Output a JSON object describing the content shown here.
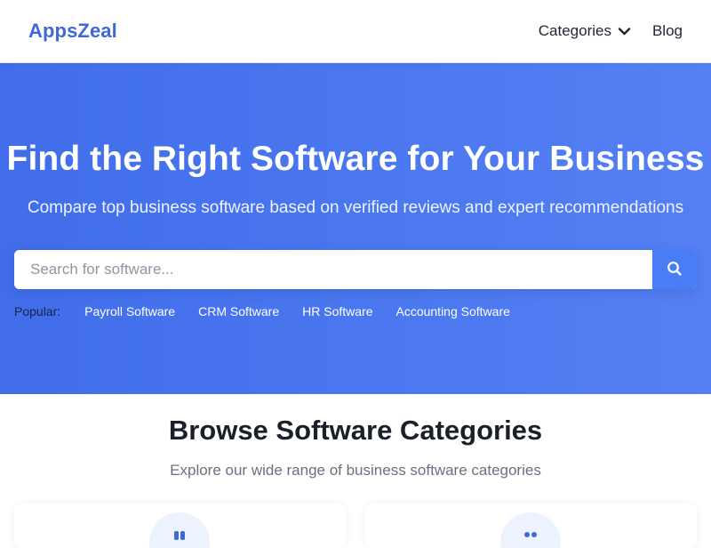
{
  "header": {
    "logo": "AppsZeal",
    "nav": [
      {
        "label": "Categories"
      },
      {
        "label": "Blog"
      }
    ]
  },
  "hero": {
    "title": "Find the Right Software for Your Business",
    "subtitle": "Compare top business software based on verified reviews and expert recommendations",
    "search": {
      "placeholder": "Search for software..."
    },
    "popular": {
      "label": "Popular:",
      "links": [
        "Payroll Software",
        "CRM Software",
        "HR Software",
        "Accounting Software"
      ]
    }
  },
  "categories": {
    "title": "Browse Software Categories",
    "subtitle": "Explore our wide range of business software categories"
  },
  "colors": {
    "brand": "#3f67d8",
    "hero_start": "#416dea",
    "hero_end": "#557ff4",
    "search_button": "#4a7cf5"
  },
  "icons": {
    "categories_dropdown": "chevron-down-icon",
    "search": "search-icon",
    "card_left": "category-icon",
    "card_right": "category-icon"
  }
}
